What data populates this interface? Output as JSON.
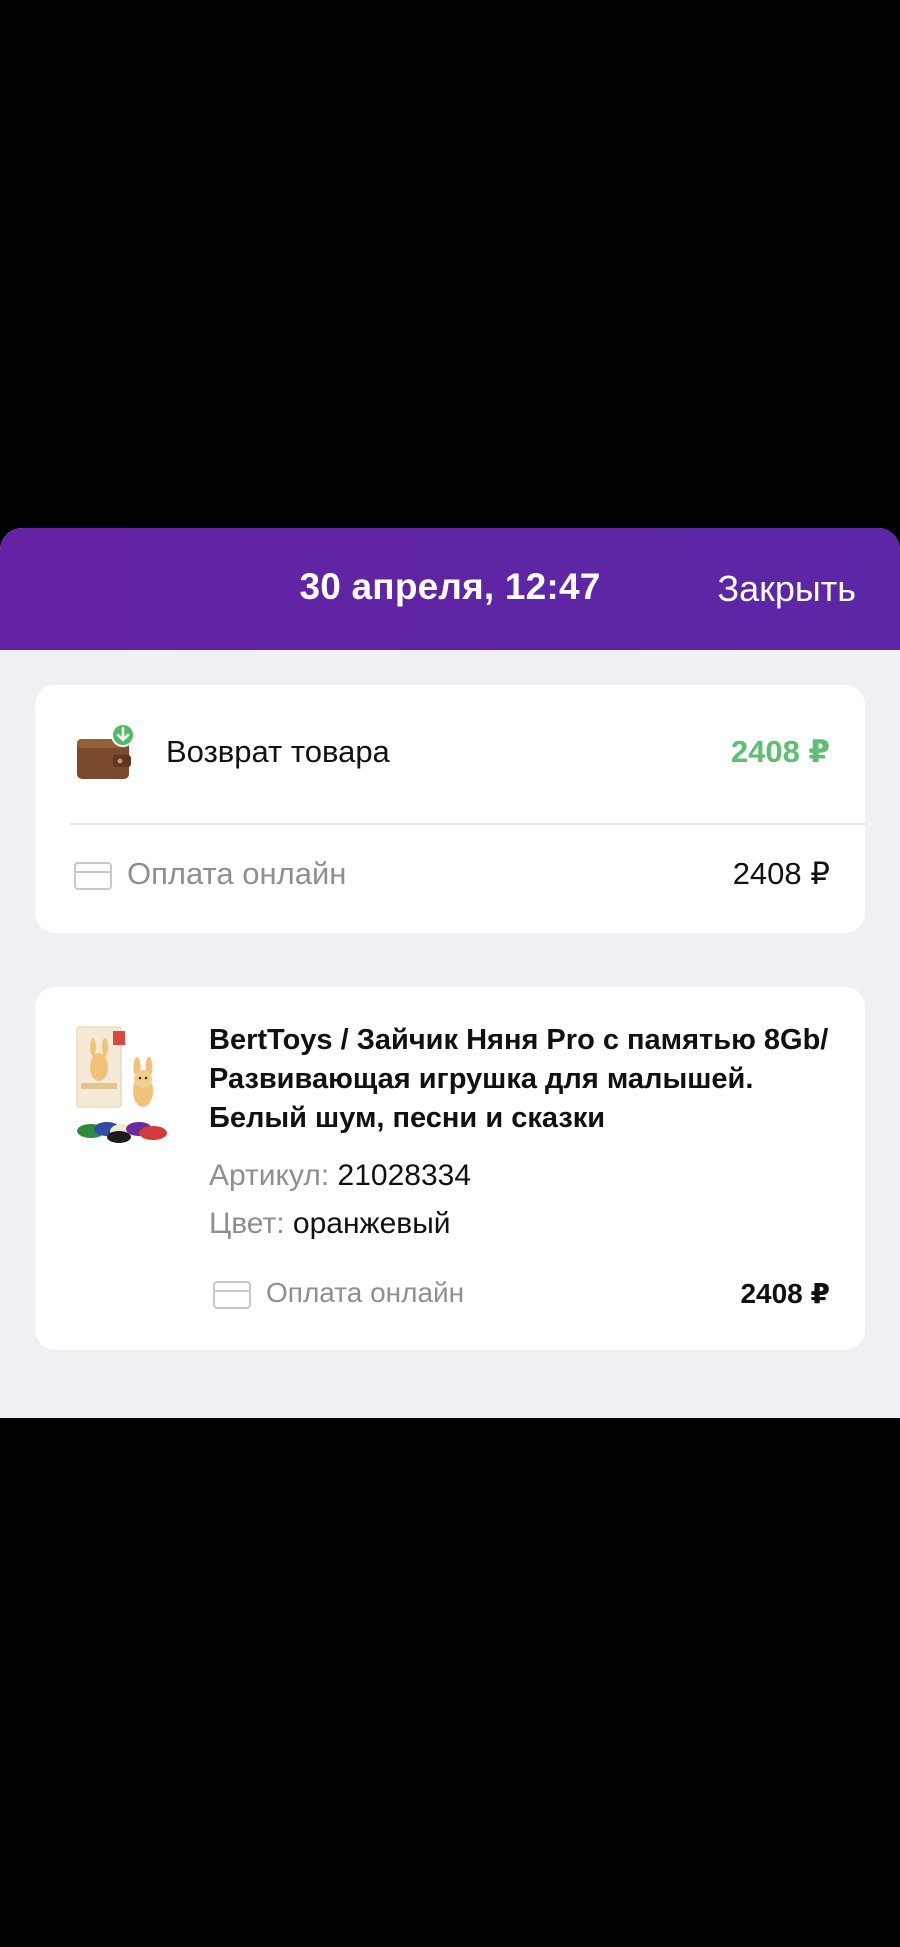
{
  "header": {
    "title": "30 апреля, 12:47",
    "close_label": "Закрыть"
  },
  "summary": {
    "return_label": "Возврат товара",
    "return_amount": "2408 ₽",
    "payment_method": "Оплата онлайн",
    "payment_amount": "2408 ₽"
  },
  "item": {
    "title": "BertToys / Зайчик Няня Pro с памятью 8Gb/ Развивающая игрушка для малышей. Белый шум, песни и сказки",
    "sku_label": "Артикул:",
    "sku_value": "21028334",
    "color_label": "Цвет:",
    "color_value": "оранжевый",
    "payment_method": "Оплата онлайн",
    "price": "2408 ₽"
  },
  "colors": {
    "header_bg": "#5f25a5",
    "return_amount": "#5cbf72",
    "sheet_bg": "#efeff4"
  },
  "icons": {
    "wallet": "wallet-refund-icon",
    "card": "credit-card-icon",
    "product": "product-thumbnail"
  }
}
